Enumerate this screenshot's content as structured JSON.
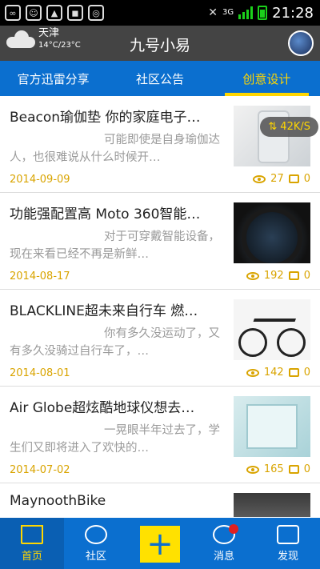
{
  "statusbar": {
    "network": "3G",
    "time": "21:28"
  },
  "header": {
    "city": "天津",
    "temperature": "14°C/23°C",
    "title": "九号小易"
  },
  "tabs": [
    {
      "label": "官方迅雷分享"
    },
    {
      "label": "社区公告"
    },
    {
      "label": "创意设计"
    }
  ],
  "active_tab": "创意设计",
  "download_speed": "42K/S",
  "articles": [
    {
      "title": "Beacon瑜伽垫 你的家庭电子…",
      "summary": "可能即使是自身瑜伽达人，也很难说从什么时候开…",
      "date": "2014-09-09",
      "views": "27",
      "comments": "0"
    },
    {
      "title": "功能强配置高 Moto 360智能…",
      "summary": "对于可穿戴智能设备，现在来看已经不再是新鲜…",
      "date": "2014-08-17",
      "views": "192",
      "comments": "0"
    },
    {
      "title": "BLACKLINE超未来自行车 燃…",
      "summary": "你有多久没运动了，又有多久没骑过自行车了，…",
      "date": "2014-08-01",
      "views": "142",
      "comments": "0"
    },
    {
      "title": "Air Globe超炫酷地球仪想去…",
      "summary": "一晃眼半年过去了，学生们又即将进入了欢快的…",
      "date": "2014-07-02",
      "views": "165",
      "comments": "0"
    },
    {
      "title": "MaynoothBike",
      "summary": "",
      "date": "",
      "views": "",
      "comments": ""
    }
  ],
  "bottom_nav": {
    "home": "首页",
    "community": "社区",
    "add": "+",
    "messages": "消息",
    "discover": "发现"
  }
}
